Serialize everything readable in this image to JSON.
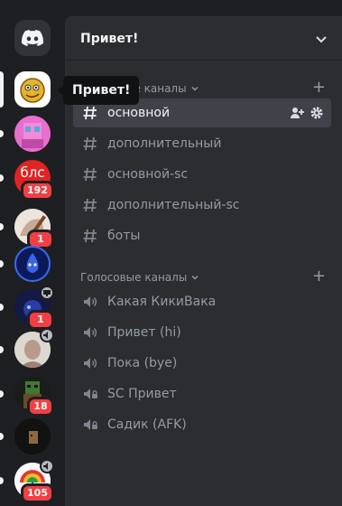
{
  "tooltip": "Привет!",
  "server": {
    "name": "Привет!",
    "text_category": "Текстовые каналы",
    "voice_category": "Голосовые каналы",
    "text_channels": [
      "основной",
      "дополнительный",
      "основной-sc",
      "дополнительный-sc",
      "боты"
    ],
    "voice_channels": [
      "Какая КикиВака",
      "Привет (hi)",
      "Пока (bye)",
      "SC Привет",
      "Садик (AFK)"
    ]
  },
  "servers": [
    {
      "badge": ""
    },
    {
      "badge": ""
    },
    {
      "badge": "192",
      "label": "блс"
    },
    {
      "badge": "1"
    },
    {
      "badge": ""
    },
    {
      "badge": "1"
    },
    {
      "badge": ""
    },
    {
      "badge": "18"
    },
    {
      "badge": ""
    },
    {
      "badge": "105"
    }
  ],
  "colors": {
    "accent_red": "#f23f43",
    "selected_bg": "#404249",
    "rail_bg": "#1e1f22",
    "panel_bg": "#2b2d31"
  }
}
